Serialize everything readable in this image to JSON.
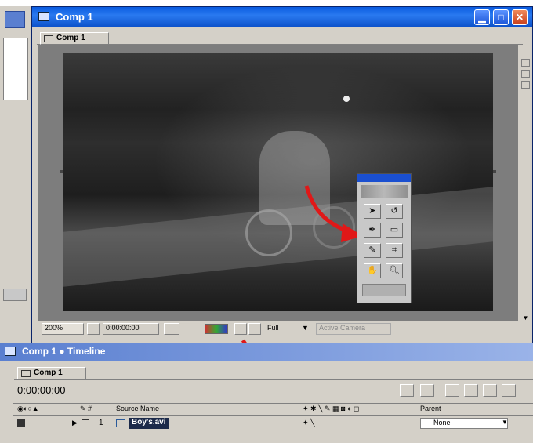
{
  "comp_window": {
    "title": "Comp 1",
    "tab_label": "Comp 1"
  },
  "viewer_footer": {
    "zoom": "200%",
    "timecode": "0:00:00:00",
    "resolution": "Full",
    "camera": "Active Camera"
  },
  "timeline_window": {
    "title": "Comp 1 ● Timeline",
    "tab_label": "Comp 1",
    "timecode": "0:00:00:00",
    "column_source_name": "Source Name",
    "column_parent": "Parent",
    "layer": {
      "number": "1",
      "name": "Boy's.avi",
      "parent_value": "None"
    }
  },
  "colors": {
    "title_bar_blue": "#0b5ce0",
    "annotation_red": "#e01818",
    "layer_highlight": "#1c2a4a"
  },
  "icons": [
    "app-icon",
    "minimize-icon",
    "maximize-icon",
    "close-icon",
    "arrow-tool-icon",
    "rotate-tool-icon",
    "pen-tool-icon",
    "hand-tool-icon",
    "zoom-tool-icon",
    "red-arrow-annotation"
  ]
}
